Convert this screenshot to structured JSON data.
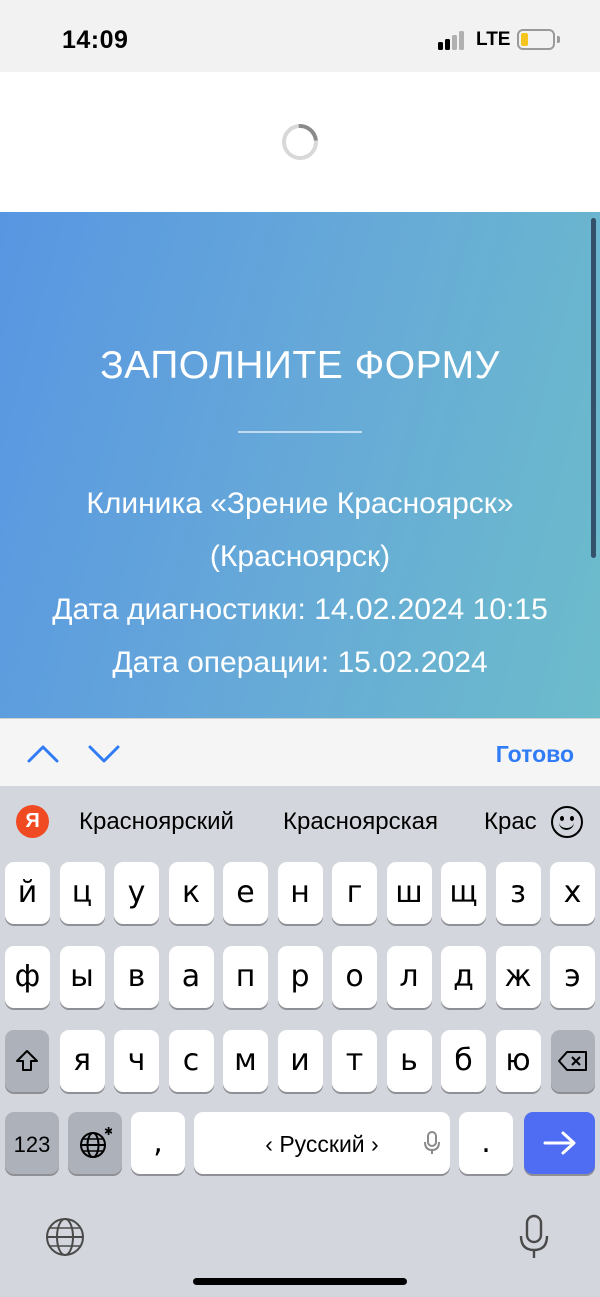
{
  "status": {
    "time": "14:09",
    "network": "LTE",
    "battery_color": "#f4c51c"
  },
  "page": {
    "title": "ЗАПОЛНИТЕ ФОРМУ",
    "clinic_line1": "Клиника «Зрение Красноярск»",
    "clinic_line2": "(Красноярск)",
    "diagnostics": "Дата диагностики: 14.02.2024 10:15",
    "operation": "Дата операции: 15.02.2024",
    "gradient_start": "#5896e2",
    "gradient_end": "#6cbccb"
  },
  "accessory": {
    "done_label": "Готово",
    "prev_icon": "chevron-up-icon",
    "next_icon": "chevron-down-icon"
  },
  "keyboard": {
    "yandex_logo": "Я",
    "suggestions": [
      "Красноярский",
      "Красноярская",
      "Красноярск"
    ],
    "row1": [
      "й",
      "ц",
      "у",
      "к",
      "е",
      "н",
      "г",
      "ш",
      "щ",
      "з",
      "х"
    ],
    "row2": [
      "ф",
      "ы",
      "в",
      "а",
      "п",
      "р",
      "о",
      "л",
      "д",
      "ж",
      "э"
    ],
    "row3": [
      "я",
      "ч",
      "с",
      "м",
      "и",
      "т",
      "ь",
      "б",
      "ю"
    ],
    "numbers_label": "123",
    "comma_label": ",",
    "space_label": "‹ Русский ›",
    "period_label": ".",
    "accent_color": "#4f6df2"
  }
}
